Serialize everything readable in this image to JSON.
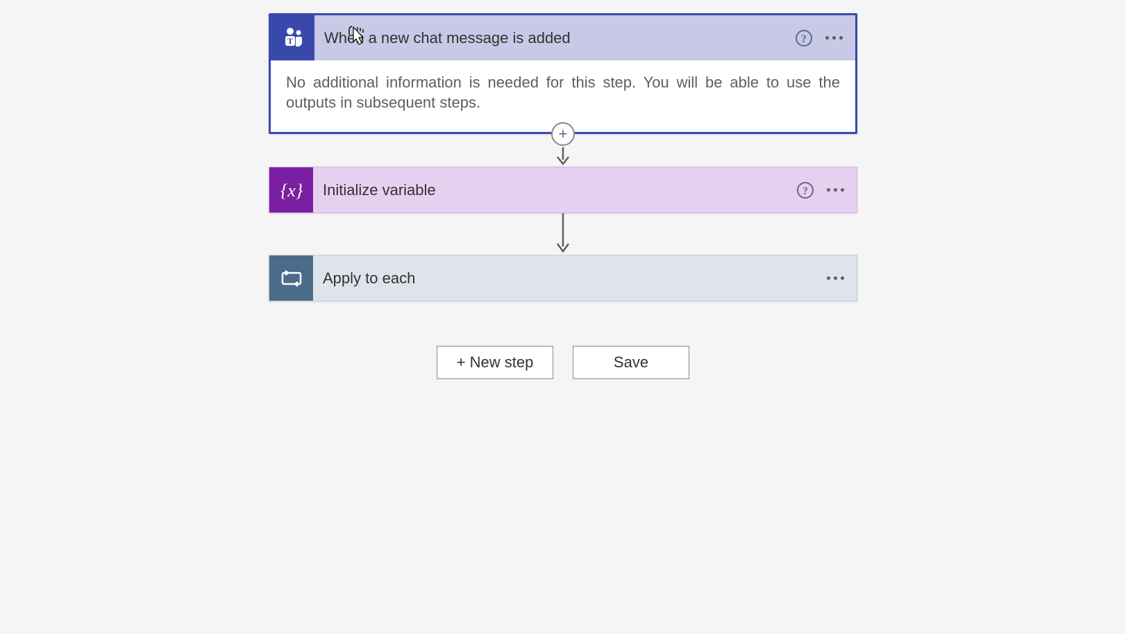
{
  "steps": {
    "trigger": {
      "title": "When a new chat message is added",
      "body": "No additional information is needed for this step. You will be able to use the outputs in subsequent steps."
    },
    "variable": {
      "title": "Initialize variable"
    },
    "apply": {
      "title": "Apply to each"
    }
  },
  "actions": {
    "new_step": "+ New step",
    "save": "Save"
  },
  "icons": {
    "teams": "teams-icon",
    "variable": "variable-icon",
    "loop": "loop-icon",
    "help": "help-icon",
    "more": "more-icon",
    "plus": "plus-icon"
  }
}
